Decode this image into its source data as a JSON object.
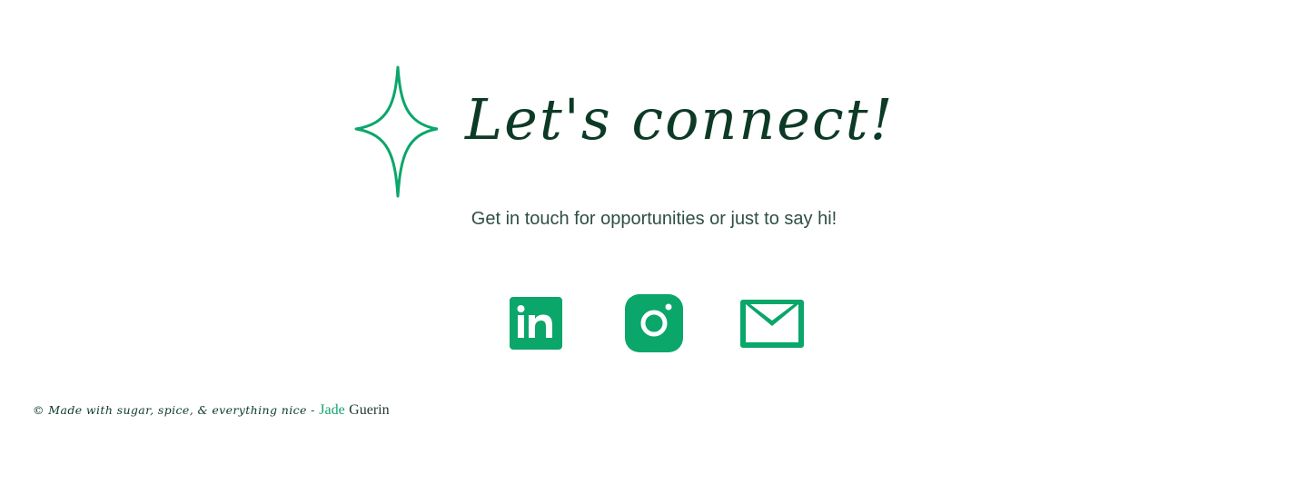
{
  "colors": {
    "accent": "#0aa66a",
    "heading": "#0d3a26",
    "subtitle": "#2f4f42",
    "footer_text": "#0d3a26"
  },
  "contact": {
    "heading": "Let's connect!",
    "subtitle": "Get in touch for opportunities or just to say hi!",
    "decoration_icon": "sparkle-icon"
  },
  "social": [
    {
      "name": "LinkedIn",
      "icon": "linkedin-icon"
    },
    {
      "name": "Instagram",
      "icon": "instagram-icon"
    },
    {
      "name": "Email",
      "icon": "mail-icon"
    }
  ],
  "footer": {
    "made_with": "© Made with sugar, spice, & everything nice -",
    "first_name": "Jade",
    "last_name": "Guerin"
  }
}
